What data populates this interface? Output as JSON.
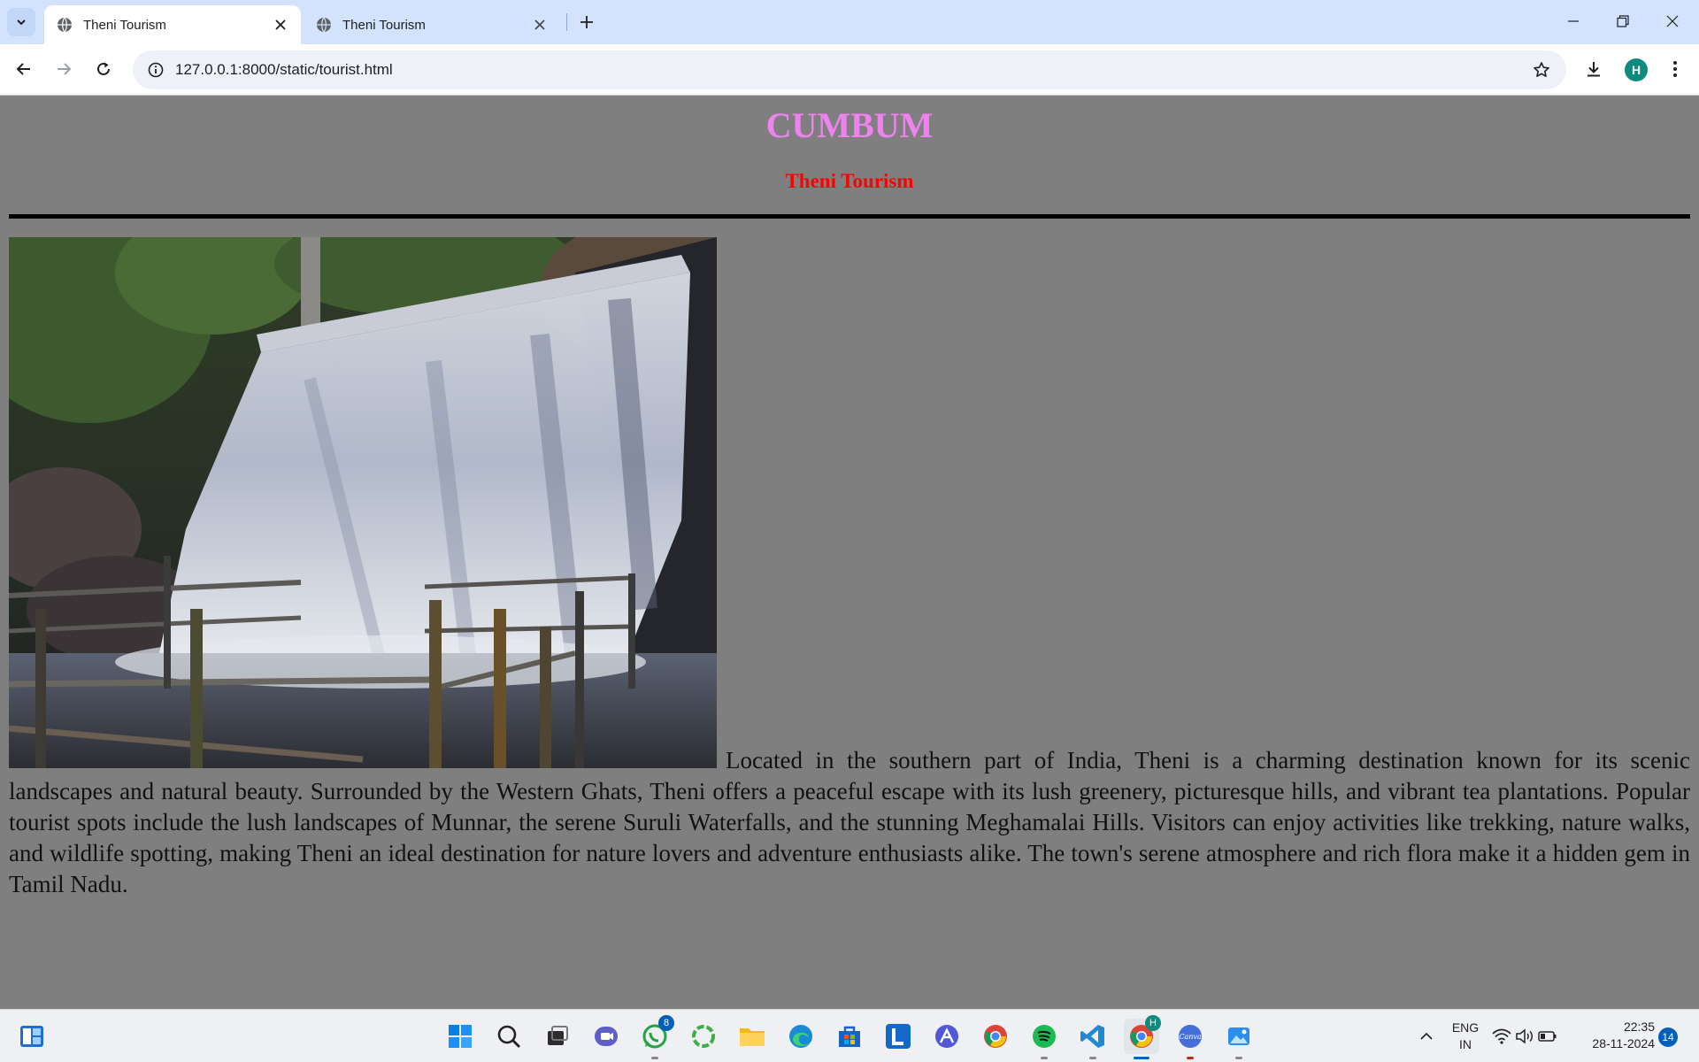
{
  "browser": {
    "tabs": [
      {
        "title": "Theni Tourism",
        "active": true
      },
      {
        "title": "Theni Tourism",
        "active": false
      }
    ],
    "url": "127.0.0.1:8000/static/tourist.html",
    "profile_initial": "H"
  },
  "page": {
    "heading": "CUMBUM",
    "subheading": "Theni Tourism",
    "paragraph": "Located in the southern part of India, Theni is a charming destination known for its scenic landscapes and natural beauty. Surrounded by the Western Ghats, Theni offers a peaceful escape with its lush greenery, picturesque hills, and vibrant tea plantations. Popular tourist spots include the lush landscapes of Munnar, the serene Suruli Waterfalls, and the stunning Meghamalai Hills. Visitors can enjoy activities like trekking, nature walks, and wildlife spotting, making Theni an ideal destination for nature lovers and adventure enthusiasts alike. The town's serene atmosphere and rich flora make it a hidden gem in Tamil Nadu.",
    "colors": {
      "background": "#7f7f7f",
      "heading": "#ee82ee",
      "subheading": "#ff0000"
    }
  },
  "taskbar": {
    "apps": [
      "widgets-icon",
      "start-icon",
      "search-icon",
      "task-view-icon",
      "teams-icon",
      "whatsapp-icon",
      "copilot-icon",
      "file-explorer-icon",
      "edge-icon",
      "store-icon",
      "l-app-icon",
      "app-icon",
      "chrome-icon",
      "spotify-icon",
      "vscode-icon",
      "chrome-profile-icon",
      "canva-icon",
      "photos-icon"
    ],
    "whatsapp_badge": "8",
    "chrome_profile_badge": "H",
    "canva_label": "Canva",
    "language_line1": "ENG",
    "language_line2": "IN",
    "time": "22:35",
    "date": "28-11-2024",
    "notification_count": "14"
  }
}
